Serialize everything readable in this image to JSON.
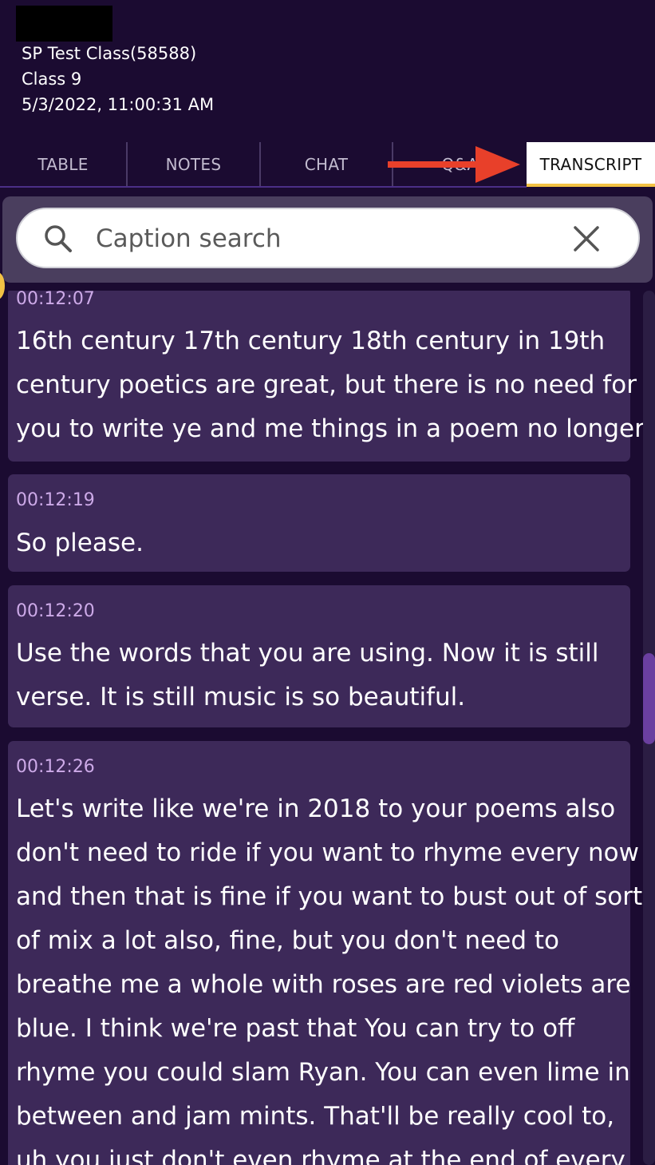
{
  "header": {
    "class_name": "SP Test Class(58588)",
    "class_number": "Class 9",
    "datetime": "5/3/2022, 11:00:31 AM"
  },
  "tabs": [
    {
      "label": "TABLE"
    },
    {
      "label": "NOTES"
    },
    {
      "label": "CHAT"
    },
    {
      "label": "Q&A"
    },
    {
      "label": "TRANSCRIPT",
      "active": true
    }
  ],
  "search": {
    "placeholder": "Caption search",
    "value": ""
  },
  "transcript": [
    {
      "time": "00:12:07",
      "lines": [
        "16th century 17th century 18th century in 19th",
        "century poetics are great, but there is no need for",
        "you to write ye and me things in a poem no longer"
      ]
    },
    {
      "time": "00:12:19",
      "lines": [
        "So please."
      ]
    },
    {
      "time": "00:12:20",
      "lines": [
        "Use the words that you are using. Now it is still",
        "verse. It is still music is so beautiful."
      ]
    },
    {
      "time": "00:12:26",
      "lines": [
        "Let's write like we're in 2018 to your poems also",
        "don't need to ride if you want to rhyme every now",
        "and then that is fine if you want to bust out of sort",
        "of mix a lot also, fine, but you don't need to",
        "breathe me a whole with roses are red violets are",
        "blue. I think we're past that You can try to off",
        "rhyme you could slam Ryan. You can even lime in",
        "between and jam mints. That'll be really cool to,",
        "uh you just don't even rhyme at the end of every"
      ]
    }
  ],
  "colors": {
    "background": "#1b0b31",
    "card": "#3d2959",
    "timestamp": "#cdaae8",
    "active_tab_underline": "#f3c244",
    "arrow": "#e8402a"
  },
  "icons": [
    "search-icon",
    "close-icon",
    "red-arrow-icon"
  ]
}
